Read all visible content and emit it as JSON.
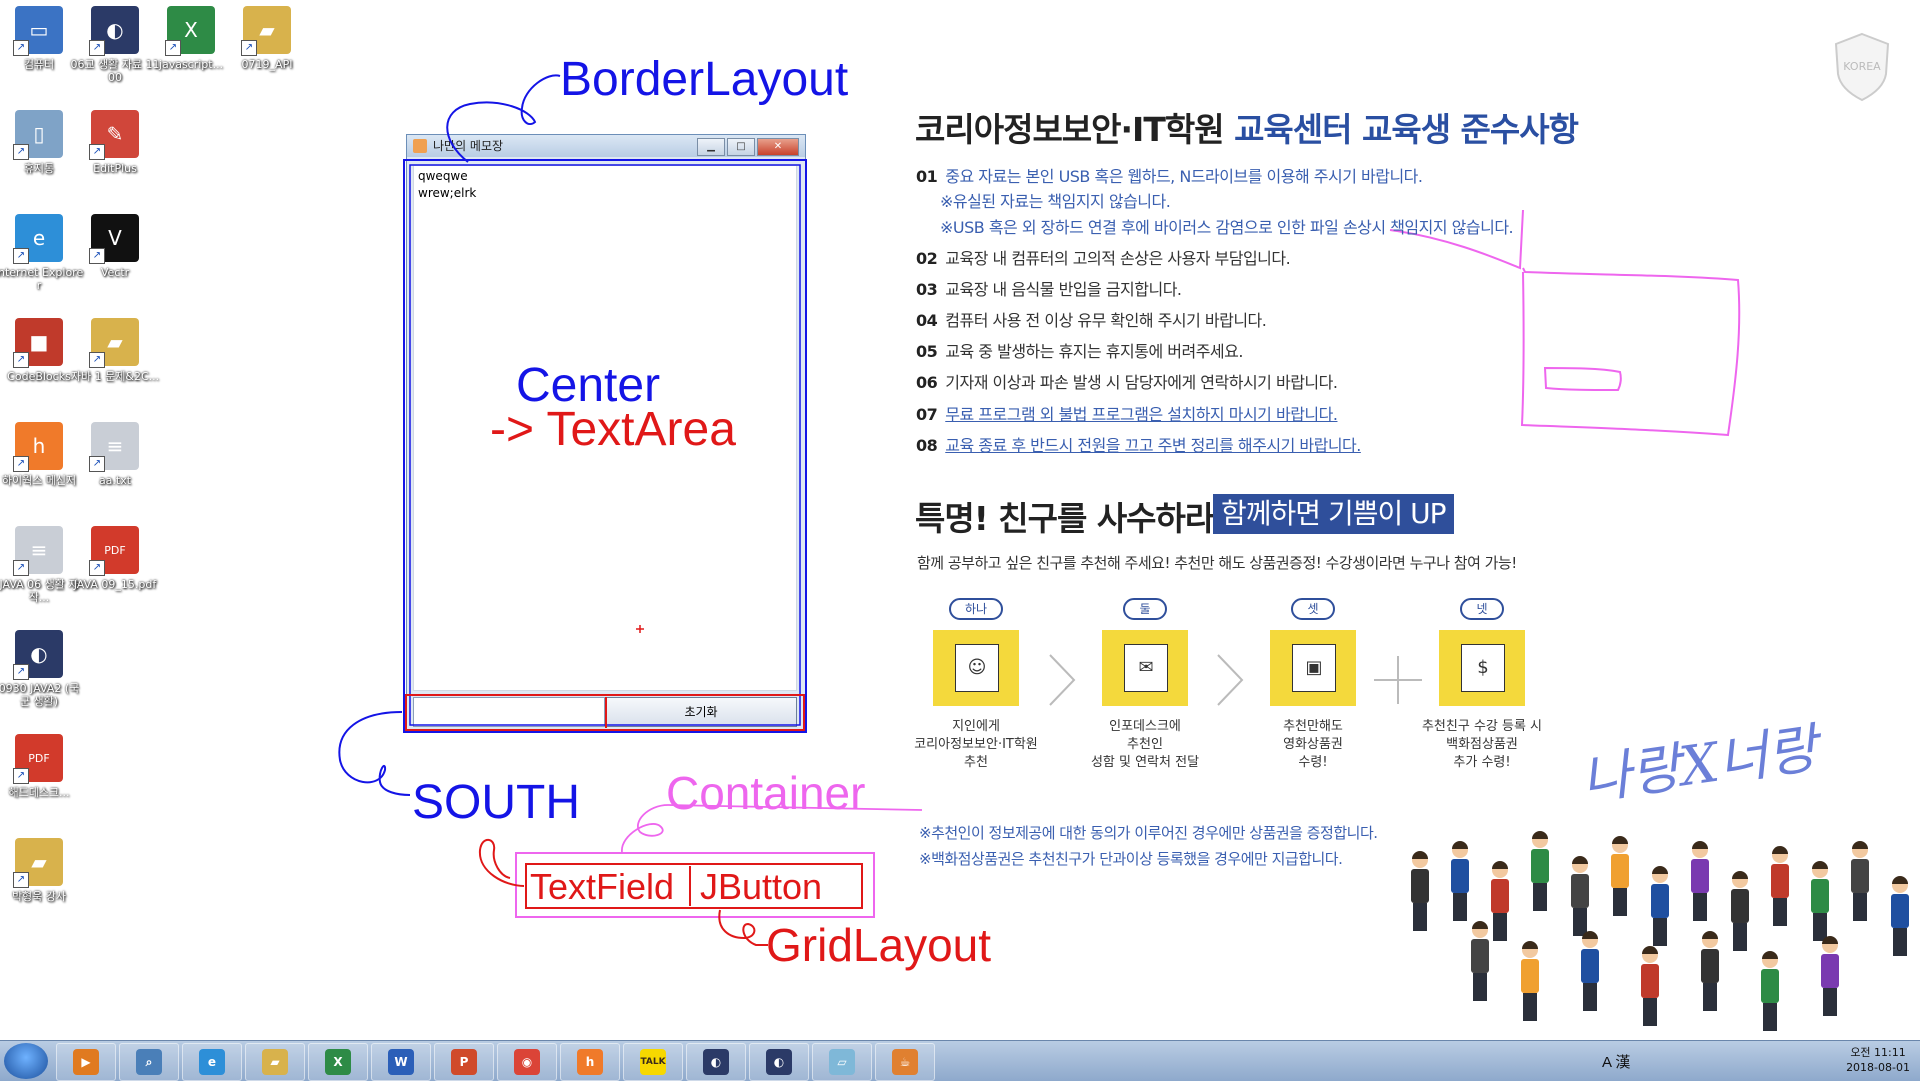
{
  "desktop_icons": [
    {
      "label": "컴퓨터",
      "color": "#3b73c4",
      "glyph": "▭"
    },
    {
      "label": "06교 생활 자료 1100",
      "color": "#2b3a67",
      "glyph": "◐"
    },
    {
      "label": "javascript...",
      "color": "#2e8b46",
      "glyph": "X"
    },
    {
      "label": "0719_API",
      "color": "#d8b24c",
      "glyph": "▰"
    },
    {
      "label": "휴지통",
      "color": "#7fa3c7",
      "glyph": "▯"
    },
    {
      "label": "EditPlus",
      "color": "#d0463a",
      "glyph": "✎"
    },
    {
      "label": "Internet Explorer",
      "color": "#2d8fd8",
      "glyph": "e"
    },
    {
      "label": "Vectr",
      "color": "#111111",
      "glyph": "V"
    },
    {
      "label": "CodeBlocks",
      "color": "#c03a2b",
      "glyph": "■"
    },
    {
      "label": "자바 1 문제&2C...",
      "color": "#d8b24c",
      "glyph": "▰"
    },
    {
      "label": "하이웍스 메신저",
      "color": "#f07a2a",
      "glyph": "h"
    },
    {
      "label": "aa.txt",
      "color": "#c9ced6",
      "glyph": "≡"
    },
    {
      "label": "JAVA 06 생활 자작...",
      "color": "#c9ced6",
      "glyph": "≡"
    },
    {
      "label": "JAVA 09_15.pdf",
      "color": "#d23a2b",
      "glyph": "PDF"
    },
    {
      "label": "0930 JAVA2 (국군 생활)",
      "color": "#2b3a67",
      "glyph": "◐"
    },
    {
      "label": "해드데스크...",
      "color": "#d23a2b",
      "glyph": "PDF"
    },
    {
      "label": "박형욱 강사",
      "color": "#d8b24c",
      "glyph": "▰"
    }
  ],
  "java_window": {
    "title": "나만의 메모장",
    "minimize": "▁",
    "maximize": "□",
    "close": "✕",
    "text_lines": [
      "qweqwe",
      "wrew;elrk"
    ],
    "button_label": "초기화",
    "textfield_value": ""
  },
  "annotations": {
    "border_layout": "BorderLayout",
    "center": "Center",
    "text_area": "-> TextArea",
    "south": "SOUTH",
    "container": "Container",
    "text_field": "TextField",
    "j_button": "JButton",
    "grid_layout": "GridLayout",
    "colors": {
      "blue": "#1414e6",
      "red": "#e01818",
      "pink": "#ee66ee"
    }
  },
  "notice": {
    "title_plain": "코리아정보보안·IT학원 ",
    "title_highlight": "교육센터 교육생 준수사항",
    "rules": [
      {
        "num": "01",
        "text": "중요 자료는 본인 USB 혹은 웹하드, N드라이브를 이용해 주시기 바랍니다.",
        "style": "blue"
      },
      {
        "num": "",
        "text": "※유실된 자료는 책임지지 않습니다.",
        "style": "blue"
      },
      {
        "num": "",
        "text": "※USB 혹은 외 장하드 연결 후에 바이러스 감염으로  인한 파일 손상시 책임지지 않습니다.",
        "style": "blue"
      },
      {
        "num": "02",
        "text": "교육장 내 컴퓨터의 고의적 손상은 사용자 부담입니다.",
        "style": "plain"
      },
      {
        "num": "03",
        "text": "교육장 내 음식물 반입을 금지합니다.",
        "style": "plain"
      },
      {
        "num": "04",
        "text": "컴퓨터 사용 전 이상 유무 확인해 주시기 바랍니다.",
        "style": "plain"
      },
      {
        "num": "05",
        "text": "교육 중 발생하는 휴지는 휴지통에 버려주세요.",
        "style": "plain"
      },
      {
        "num": "06",
        "text": "기자재 이상과 파손 발생 시 담당자에게 연락하시기 바랍니다.",
        "style": "plain"
      },
      {
        "num": "07",
        "text": "무료 프로그램 외 불법 프로그램은 설치하지 마시기 바랍니다.",
        "style": "underline"
      },
      {
        "num": "08",
        "text": "교육 종료 후 반드시 전원을 끄고 주변 정리를 해주시기 바랍니다.",
        "style": "underline"
      }
    ],
    "friend_title": "특명! 친구를 사수하라!",
    "friend_badge": "함께하면 기쁨이 UP",
    "friend_desc": "함께 공부하고 싶은 친구를 추천해 주세요! 추천만 해도 상품권증정! 수강생이라면 누구나 참여 가능!",
    "steps": [
      {
        "pill": "하나",
        "icon": "☺",
        "caption": "지인에게\n코리아정보보안·IT학원\n추천"
      },
      {
        "pill": "둘",
        "icon": "✉",
        "caption": "인포데스크에\n추천인\n성함 및 연락처 전달"
      },
      {
        "pill": "셋",
        "icon": "▣",
        "caption": "추천만해도\n영화상품권\n수령!"
      },
      {
        "pill": "넷",
        "icon": "$",
        "caption": "추천친구 수강 등록 시\n백화점상품권\n추가 수령!"
      }
    ],
    "notes": [
      "※추천인이 정보제공에 대한 동의가 이루어진 경우에만 상품권을 증정합니다.",
      "※백화점상품권은 추천친구가 단과이상 등록했을 경우에만 지급합니다."
    ],
    "korea_badge": "KOREA",
    "slogan": "나랑X너랑"
  },
  "taskbar": {
    "buttons": [
      {
        "name": "media-player",
        "color": "#e07a20",
        "glyph": "▶"
      },
      {
        "name": "search-tool",
        "color": "#4a7fb8",
        "glyph": "⌕"
      },
      {
        "name": "internet-explorer",
        "color": "#2d8fd8",
        "glyph": "e"
      },
      {
        "name": "file-explorer",
        "color": "#d8b24c",
        "glyph": "▰"
      },
      {
        "name": "excel",
        "color": "#2e8b46",
        "glyph": "X"
      },
      {
        "name": "word",
        "color": "#2b5fb8",
        "glyph": "W"
      },
      {
        "name": "powerpoint",
        "color": "#d04a2a",
        "glyph": "P"
      },
      {
        "name": "chrome",
        "color": "#db4437",
        "glyph": "◉"
      },
      {
        "name": "hiworks",
        "color": "#f07a2a",
        "glyph": "h"
      },
      {
        "name": "kakaotalk",
        "color": "#f7d800",
        "glyph": "TALK"
      },
      {
        "name": "eclipse-1",
        "color": "#2b3a67",
        "glyph": "◐"
      },
      {
        "name": "eclipse-2",
        "color": "#2b3a67",
        "glyph": "◐"
      },
      {
        "name": "notepad-app",
        "color": "#7fb8d8",
        "glyph": "▱"
      },
      {
        "name": "java-app",
        "color": "#e08030",
        "glyph": "☕"
      }
    ],
    "tray_text": "A 漢",
    "clock_time": "오전 11:11",
    "clock_date": "2018-08-01"
  }
}
